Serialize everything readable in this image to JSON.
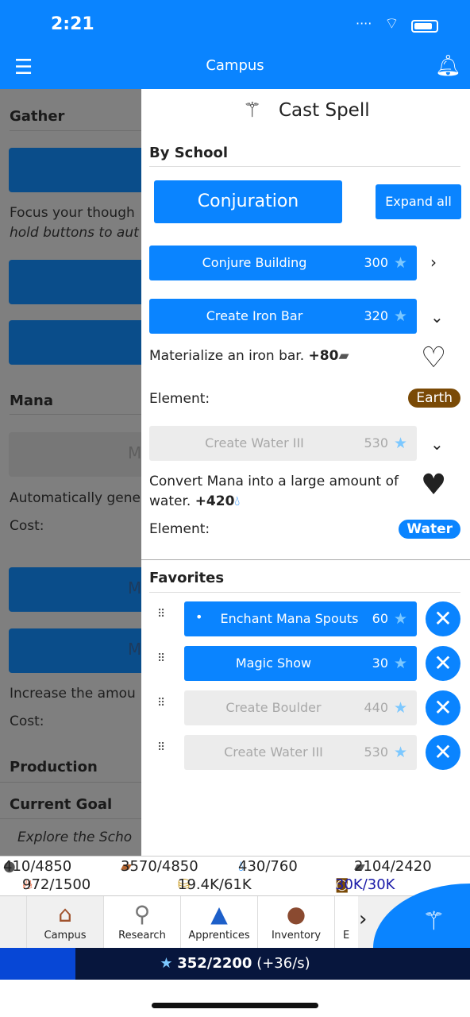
{
  "status": {
    "time": "2:21"
  },
  "nav": {
    "title": "Campus"
  },
  "background": {
    "gather": "Gather",
    "focus_text": "Focus your though",
    "hold_text": "hold buttons to aut",
    "mana": "Mana",
    "mana_btn": "M",
    "auto_text": "Automatically gene",
    "cost": "Cost:",
    "m1": "M",
    "m2": "M",
    "increase_text": "Increase the amou",
    "production": "Production",
    "current_goal": "Current Goal",
    "goal_text": "Explore the Scho"
  },
  "panel": {
    "title": "Cast Spell",
    "by_school": "By School",
    "school": "Conjuration",
    "expand_all": "Expand all",
    "spells": [
      {
        "name": "Conjure Building",
        "cost": "300",
        "enabled": true
      },
      {
        "name": "Create Iron Bar",
        "cost": "320",
        "enabled": true,
        "desc": "Materialize an iron bar.",
        "gain": "+80",
        "element_label": "Element:",
        "element": "Earth",
        "element_color": "#7a4a06",
        "favorite": false
      },
      {
        "name": "Create Water III",
        "cost": "530",
        "enabled": false,
        "desc1": "Convert Mana into a large amount of",
        "desc2": "water.",
        "gain": "+420",
        "element_label": "Element:",
        "element": "Water",
        "element_color": "#0a84ff",
        "favorite": true
      }
    ],
    "favorites_title": "Favorites",
    "favorites": [
      {
        "name": "Enchant Mana Spouts",
        "cost": "60",
        "enabled": true,
        "active": true
      },
      {
        "name": "Magic Show",
        "cost": "30",
        "enabled": true
      },
      {
        "name": "Create Boulder",
        "cost": "440",
        "enabled": false
      },
      {
        "name": "Create Water III",
        "cost": "530",
        "enabled": false
      }
    ]
  },
  "resources": {
    "stone": "410/4850",
    "wood": "3570/4850",
    "water": "430/760",
    "iron": "2104/2420",
    "fire": "972/1500",
    "gold": "19.4K/61K",
    "time": "30K/30K"
  },
  "tabs": [
    {
      "label": "Campus"
    },
    {
      "label": "Research"
    },
    {
      "label": "Apprentices"
    },
    {
      "label": "Inventory"
    },
    {
      "label": "E"
    }
  ],
  "mana": {
    "value": "352/2200",
    "rate": "(+36/s)",
    "fraction": 0.16
  },
  "colors": {
    "accent": "#0a84ff",
    "mana_bar": "#07163d"
  }
}
